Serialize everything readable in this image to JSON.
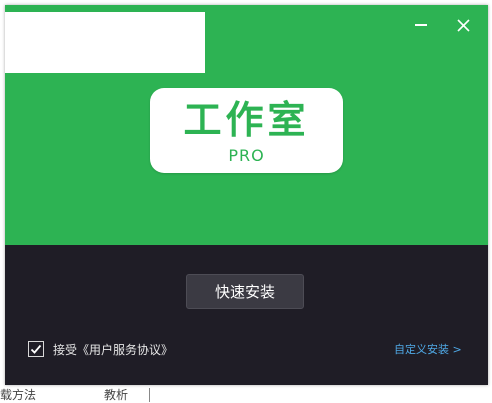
{
  "window": {
    "minimize_label": "—",
    "close_label": "✕"
  },
  "logo": {
    "main": "工作室",
    "sub": "PRO"
  },
  "install": {
    "quick_install_label": "快速安装",
    "agree_text": "接受《用户服务协议》",
    "agree_checked": true,
    "custom_install_label": "自定义安装 >"
  },
  "background_text": {
    "left": "载方法",
    "mid": "教析"
  },
  "colors": {
    "brand_green": "#2db353",
    "dark_panel": "#1f1d26",
    "button": "#3b3a43",
    "link_blue": "#4fa9e6"
  }
}
